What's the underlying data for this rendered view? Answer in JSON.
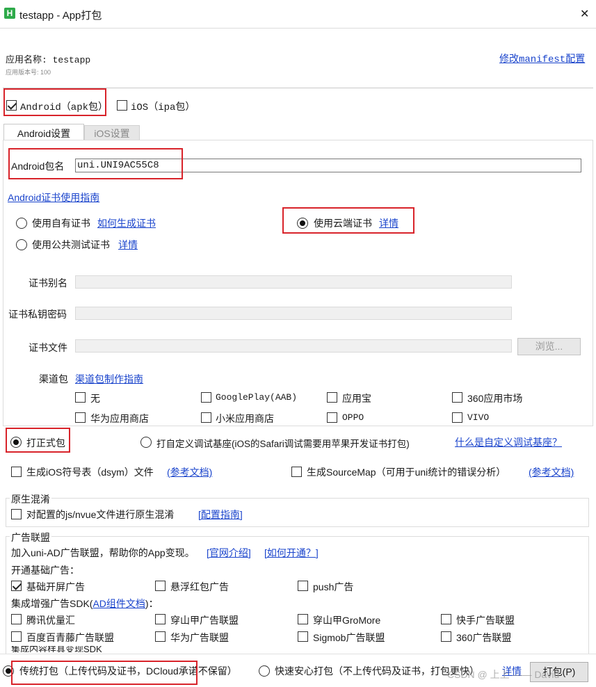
{
  "window": {
    "title": "testapp - App打包",
    "app_icon_glyph": "H",
    "close_glyph": "✕"
  },
  "header": {
    "app_name": "应用名称: testapp",
    "version": "应用版本号: 100",
    "manifest_link": "修改manifest配置"
  },
  "platforms": {
    "android": "Android（apk包）",
    "ios": "iOS（ipa包）"
  },
  "tabs": [
    "Android设置",
    "iOS设置"
  ],
  "android": {
    "package_label": "Android包名",
    "package_value": "uni.UNI9AC55C8",
    "cert_guide_link": "Android证书使用指南",
    "cert_own": "使用自有证书",
    "cert_own_link": "如何生成证书",
    "cert_cloud": "使用云端证书",
    "cert_cloud_link": "详情",
    "cert_public": "使用公共测试证书",
    "cert_public_link": "详情",
    "alias_label": "证书别名",
    "password_label": "证书私钥密码",
    "file_label": "证书文件",
    "browse_button": "浏览...",
    "channel_label": "渠道包",
    "channel_link": "渠道包制作指南",
    "channels": [
      "无",
      "GooglePlay(AAB)",
      "应用宝",
      "360应用市场",
      "华为应用商店",
      "小米应用商店",
      "OPPO",
      "VIVO"
    ]
  },
  "build_mode": {
    "formal": "打正式包",
    "custom_base": "打自定义调试基座(iOS的Safari调试需要用苹果开发证书打包)",
    "custom_base_link": "什么是自定义调试基座？"
  },
  "options": {
    "dsym": "生成iOS符号表（dsym）文件",
    "dsym_link": "(参考文档)",
    "sourcemap": "生成SourceMap（可用于uni统计的错误分析）",
    "sourcemap_link": "(参考文档)"
  },
  "obfuscation": {
    "title": "原生混淆",
    "option": "对配置的js/nvue文件进行原生混淆",
    "link": "[配置指南]"
  },
  "ads": {
    "title": "广告联盟",
    "intro": "加入uni-AD广告联盟，帮助你的App变现。",
    "intro_link1": "[官网介绍]",
    "intro_link2": "[如何开通？]",
    "basic_label": "开通基础广告：",
    "basic": [
      "基础开屏广告",
      "悬浮红包广告",
      "push广告"
    ],
    "enhanced_label_prefix": "集成增强广告SDK(",
    "enhanced_label_link": "AD组件文档",
    "enhanced_label_suffix": ")：",
    "enhanced": [
      "腾讯优量汇",
      "穿山甲广告联盟",
      "穿山甲GroMore",
      "快手广告联盟",
      "百度百青藤广告联盟",
      "华为广告联盟",
      "Sigmob广告联盟",
      "360广告联盟"
    ],
    "cut_label": "集成内容样具变现SDK"
  },
  "footer": {
    "traditional": "传统打包（上传代码及证书，DCloud承诺不保留）",
    "fast": "快速安心打包（不上传代码及证书，打包更快）",
    "fast_link": "详情",
    "pack_button": "打包(P)",
    "watermark": "CSDN @ 上上 —— David"
  },
  "colors": {
    "link": "#1a44cc",
    "highlight_box": "#d8232a",
    "app_icon_bg": "#2eaa4a"
  }
}
